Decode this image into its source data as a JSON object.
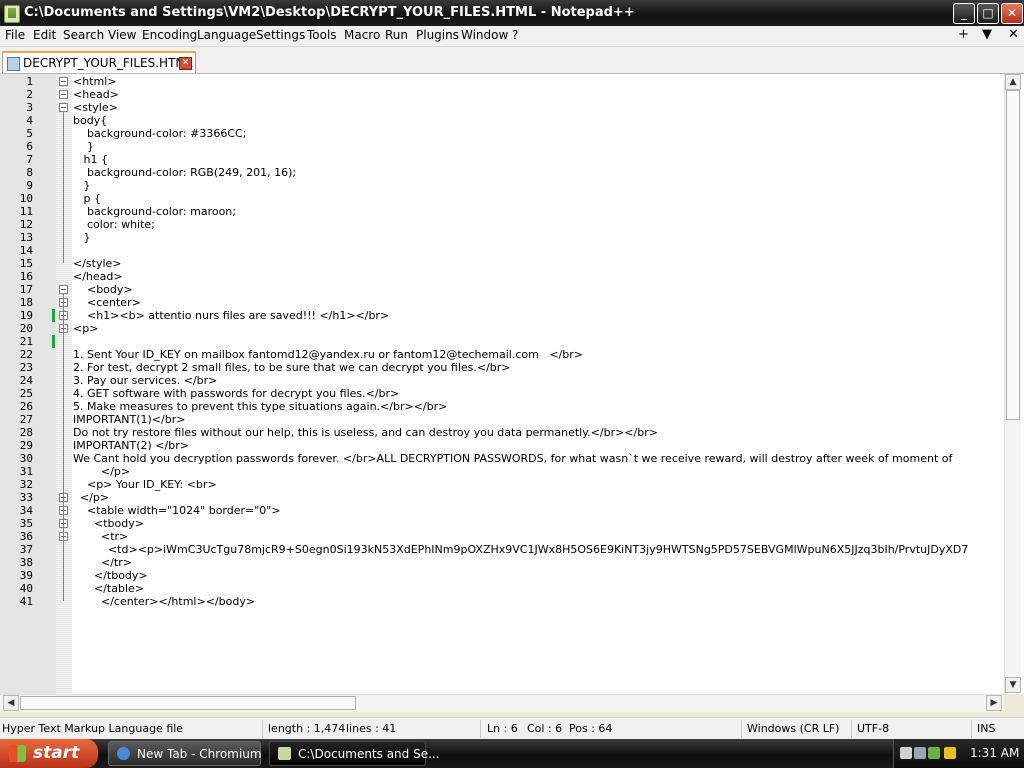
{
  "window": {
    "title": "C:\\Documents and Settings\\VM2\\Desktop\\DECRYPT_YOUR_FILES.HTML - Notepad++",
    "buttons": {
      "minimize": "_",
      "maximize": "□",
      "close": "✕"
    }
  },
  "menu": {
    "items": [
      "File",
      "Edit",
      "Search",
      "View",
      "Encoding",
      "Language",
      "Settings",
      "Tools",
      "Macro",
      "Run",
      "Plugins",
      "Window",
      "?"
    ],
    "right": [
      "+",
      "▼",
      "✕"
    ]
  },
  "tab": {
    "label": "DECRYPT_YOUR_FILES.HTML",
    "close": "✕"
  },
  "editor": {
    "lines": [
      "<html>",
      "<head>",
      "<style>",
      "body{",
      "    background-color: #3366CC;",
      "    }",
      "   h1 {",
      "    background-color: RGB(249, 201, 16);",
      "   }",
      "   p {",
      "    background-color: maroon;",
      "    color: white;",
      "   }",
      "",
      "</style>",
      "</head>",
      "    <body>",
      "    <center>",
      "    <h1><b> attentio nurs files are saved!!! </h1></br>",
      "<p>",
      "",
      "1. Sent Your ID_KEY on mailbox fantomd12@yandex.ru or fantom12@techemail.com   </br>",
      "2. For test, decrypt 2 small files, to be sure that we can decrypt you files.</br>",
      "3. Pay our services. </br>",
      "4. GET software with passwords for decrypt you files.</br>",
      "5. Make measures to prevent this type situations again.</br></br>",
      "IMPORTANT(1)</br>",
      "Do not try restore files without our help, this is useless, and can destroy you data permanetly.</br></br>",
      "IMPORTANT(2) </br>",
      "We Cant hold you decryption passwords forever. </br>ALL DECRYPTION PASSWORDS, for what wasn`t we receive reward, will destroy after week of moment of",
      "        </p>",
      "    <p> Your ID_KEY: <br>",
      "  </p>",
      "    <table width=\"1024\" border=\"0\">",
      "      <tbody>",
      "        <tr>",
      "          <td><p>iWmC3UcTgu78mjcR9+S0egn0Si193kN53XdEPhINm9pOXZHx9VC1JWx8H5OS6E9KiNT3jy9HWTSNg5PD57SEBVGMlWpuN6X5JJzq3bIh/PrvtuJDyXD7",
      "        </tr>",
      "      </tbody>",
      "      </table>",
      "        </center></html></body>"
    ],
    "changed_lines": [
      19,
      21
    ],
    "fold_boxes": [
      1,
      2,
      3,
      17,
      18,
      19,
      20,
      33,
      34,
      35,
      36
    ]
  },
  "status": {
    "file_type": "Hyper Text Markup Language file",
    "length": "length : 1,474",
    "lines": "lines : 41",
    "ln": "Ln : 6",
    "col": "Col : 6",
    "pos": "Pos : 64",
    "eol": "Windows (CR LF)",
    "encoding": "UTF-8",
    "mode": "INS"
  },
  "taskbar": {
    "start": "start",
    "tasks": [
      {
        "label": "New Tab - Chromium",
        "active": false,
        "icon_color": "#4a8ad8"
      },
      {
        "label": "C:\\Documents and Se...",
        "active": true,
        "icon_color": "#c8d8a0"
      }
    ],
    "clock": "1:31 AM"
  }
}
